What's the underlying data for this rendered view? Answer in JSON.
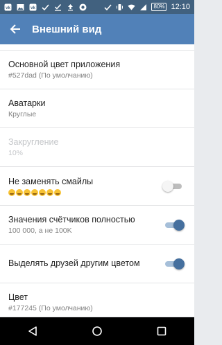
{
  "status_bar": {
    "time": "12:10",
    "battery": "80%",
    "icons": [
      "vk-icon",
      "image-icon",
      "vk-icon",
      "check-icon",
      "check-underline-icon",
      "upload-icon",
      "chrome-icon",
      "check-icon",
      "vibrate-icon",
      "wifi-icon",
      "signal-icon"
    ]
  },
  "toolbar": {
    "title": "Внешний вид",
    "background": "#5181b8"
  },
  "settings": [
    {
      "title": "Основной цвет приложения",
      "subtitle": "#527dad (По умолчанию)"
    },
    {
      "title": "Аватарки",
      "subtitle": "Круглые"
    },
    {
      "title": "Закругление",
      "subtitle": "10%",
      "disabled": true
    },
    {
      "title": "Не заменять смайлы",
      "toggle": false
    },
    {
      "title": "Значения счётчиков полностью",
      "subtitle": "100 000, а не 100K",
      "toggle": true
    },
    {
      "title": "Выделять друзей другим цветом",
      "toggle": true
    },
    {
      "title": "Цвет",
      "subtitle": "#177245 (По умолчанию)"
    }
  ],
  "colors": {
    "accent": "#5181b8",
    "toggle_on": "#456f9e",
    "status_bar": "#41617f"
  }
}
